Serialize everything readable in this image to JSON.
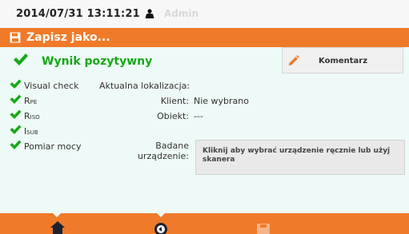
{
  "topbar": {
    "datetime": "2014/07/31 13:11:21",
    "user": "Admin",
    "user_icon": "user-icon"
  },
  "title": {
    "text": "Zapisz jako...",
    "icon": "save-icon"
  },
  "result": {
    "text": "Wynik pozytywny",
    "icon": "checkmark-icon"
  },
  "comment_button": {
    "label": "Komentarz",
    "icon": "pencil-icon"
  },
  "checks": [
    {
      "label": "Visual check",
      "sub": ""
    },
    {
      "label": "R",
      "sub": "PE"
    },
    {
      "label": "R",
      "sub": "ISO"
    },
    {
      "label": "I",
      "sub": "SUB"
    },
    {
      "label": "Pomiar mocy",
      "sub": ""
    }
  ],
  "location": {
    "title": "Aktualna lokalizacja:",
    "client_label": "Klient:",
    "client_value": "Nie wybrano",
    "object_label": "Obiekt:",
    "object_value": "---",
    "device_label_1": "Badane",
    "device_label_2": "urządzenie:",
    "device_prompt": "Kliknij aby wybrać urządzenie ręcznie lub użyj skanera"
  },
  "bottom_nav": [
    {
      "name": "home-icon",
      "enabled": true
    },
    {
      "name": "back-icon",
      "enabled": true
    },
    {
      "name": "save-icon",
      "enabled": false
    }
  ],
  "colors": {
    "accent": "#ef7a29",
    "success": "#16a816",
    "content_bg": "#eefaf7"
  }
}
